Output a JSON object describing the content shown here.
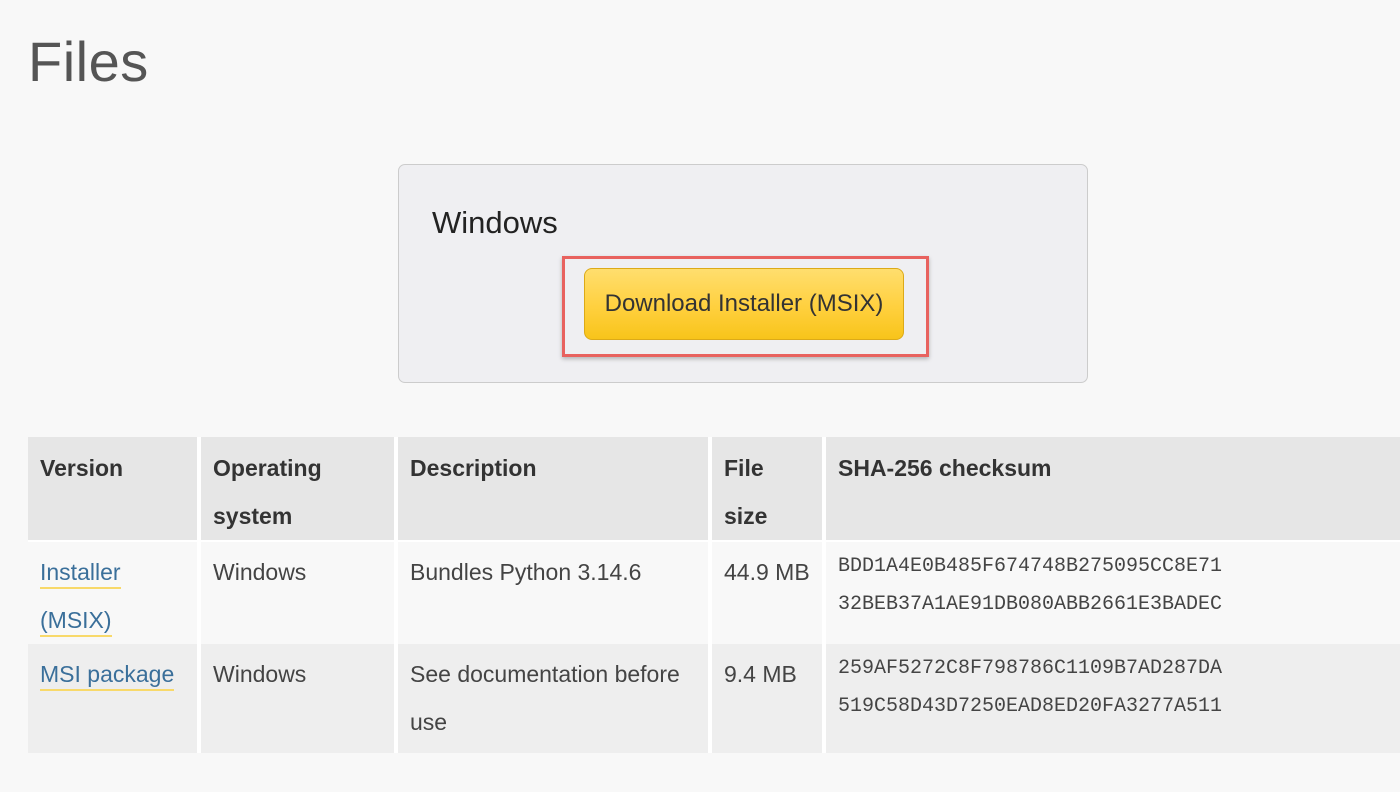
{
  "page": {
    "title": "Files"
  },
  "download": {
    "platform": "Windows",
    "button_label": "Download Installer (MSIX)"
  },
  "table": {
    "headers": {
      "version": "Version",
      "os": "Operating system",
      "description": "Description",
      "size": "File size",
      "checksum": "SHA-256 checksum"
    },
    "rows": [
      {
        "version": "Installer (MSIX)",
        "os": "Windows",
        "description": "Bundles Python 3.14.6",
        "size": "44.9 MB",
        "checksum_line1": "BDD1A4E0B485F674748B275095CC8E71",
        "checksum_line2": "32BEB37A1AE91DB080ABB2661E3BADEC"
      },
      {
        "version": "MSI package",
        "os": "Windows",
        "description": "See documentation before use",
        "size": "9.4 MB",
        "checksum_line1": "259AF5272C8F798786C1109B7AD287DA",
        "checksum_line2": "519C58D43D7250EAD8ED20FA3277A511"
      }
    ]
  },
  "colors": {
    "button": "#ffd03e",
    "highlight": "#e8625f",
    "link": "#3a6f9a",
    "checksum": "#1f8a1f"
  }
}
